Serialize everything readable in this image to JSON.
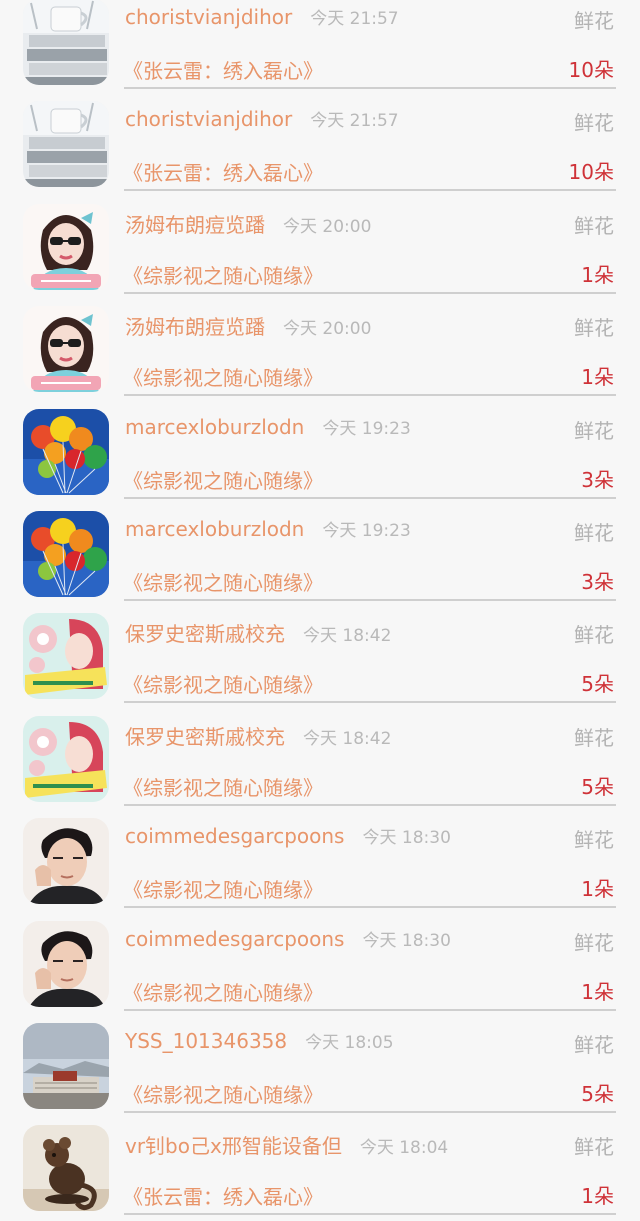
{
  "gift_label": "鲜花",
  "items": [
    {
      "user": "choristvianjdihor",
      "time": "今天 21:57",
      "book": "《张云雷：绣入磊心》",
      "count": "10朵",
      "avatar": "teacup-books-photo"
    },
    {
      "user": "choristvianjdihor",
      "time": "今天 21:57",
      "book": "《张云雷：绣入磊心》",
      "count": "10朵",
      "avatar": "teacup-books-photo"
    },
    {
      "user": "汤姆布朗痘览蹯",
      "time": "今天 20:00",
      "book": "《综影视之随心随缘》",
      "count": "1朵",
      "avatar": "girl-sunglasses-cartoon"
    },
    {
      "user": "汤姆布朗痘览蹯",
      "time": "今天 20:00",
      "book": "《综影视之随心随缘》",
      "count": "1朵",
      "avatar": "girl-sunglasses-cartoon"
    },
    {
      "user": "marcexloburzlodn",
      "time": "今天 19:23",
      "book": "《综影视之随心随缘》",
      "count": "3朵",
      "avatar": "balloons"
    },
    {
      "user": "marcexloburzlodn",
      "time": "今天 19:23",
      "book": "《综影视之随心随缘》",
      "count": "3朵",
      "avatar": "balloons"
    },
    {
      "user": "保罗史密斯戚校充",
      "time": "今天 18:42",
      "book": "《综影视之随心随缘》",
      "count": "5朵",
      "avatar": "pink-hair-girl-cartoon"
    },
    {
      "user": "保罗史密斯戚校充",
      "time": "今天 18:42",
      "book": "《综影视之随心随缘》",
      "count": "5朵",
      "avatar": "pink-hair-girl-cartoon"
    },
    {
      "user": "coimmedesgarcpoons",
      "time": "今天 18:30",
      "book": "《综影视之随心随缘》",
      "count": "1朵",
      "avatar": "young-man-portrait"
    },
    {
      "user": "coimmedesgarcpoons",
      "time": "今天 18:30",
      "book": "《综影视之随心随缘》",
      "count": "1朵",
      "avatar": "young-man-portrait"
    },
    {
      "user": "YSS_101346358",
      "time": "今天 18:05",
      "book": "《综影视之随心随缘》",
      "count": "5朵",
      "avatar": "potala-palace-landscape"
    },
    {
      "user": "vr钊bo己x邢智能设备但",
      "time": "今天 18:04",
      "book": "《张云雷：绣入磊心》",
      "count": "1朵",
      "avatar": "bronze-mouse-statue"
    }
  ]
}
